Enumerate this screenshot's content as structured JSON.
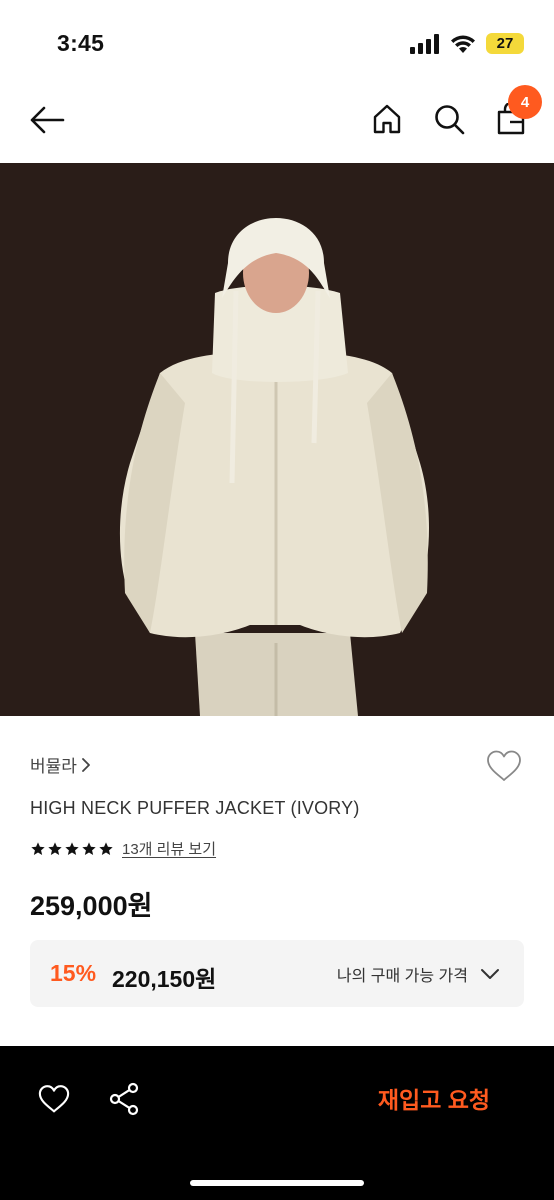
{
  "status_bar": {
    "time": "3:45",
    "battery": "27"
  },
  "nav": {
    "cart_count": "4"
  },
  "product": {
    "brand": "버뮬라",
    "name": "HIGH NECK PUFFER JACKET (IVORY)",
    "review_link": "13개 리뷰 보기",
    "price": "259,000원",
    "discount_rate": "15%",
    "discount_price": "220,150원",
    "my_price_label": "나의 구매 가능 가격",
    "star_count": 5
  },
  "bottom_bar": {
    "restock_label": "재입고 요청"
  },
  "colors": {
    "accent": "#ff5a1f",
    "image_bg": "#2a1d18",
    "box_bg": "#f4f4f4",
    "battery": "#f4d93a"
  },
  "icons": [
    "arrow-left-icon",
    "home-icon",
    "search-icon",
    "bag-icon",
    "chevron-right-icon",
    "heart-icon",
    "star-icon",
    "chevron-down-icon",
    "share-icon"
  ]
}
